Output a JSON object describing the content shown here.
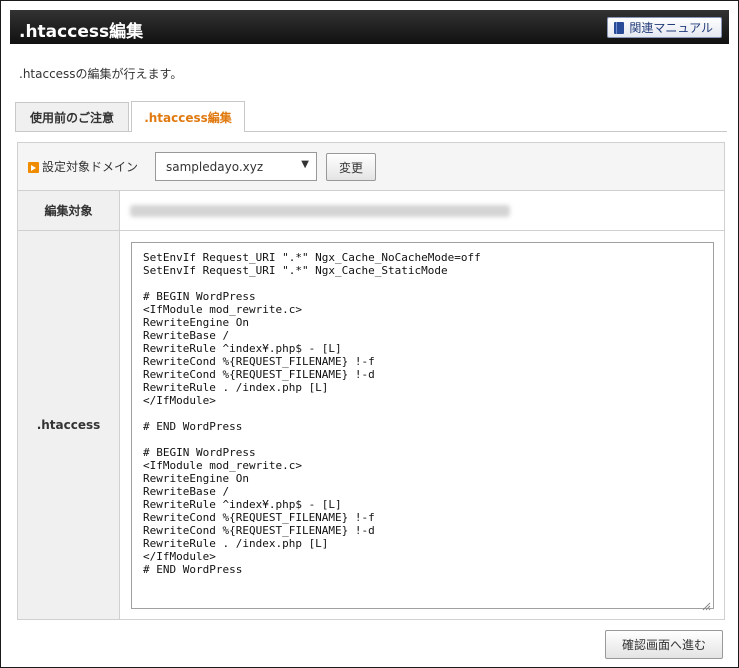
{
  "header": {
    "title": ".htaccess編集",
    "manual_label": "関連マニュアル"
  },
  "intro_text": ".htaccessの編集が行えます。",
  "tabs": [
    {
      "label": "使用前のご注意",
      "active": false
    },
    {
      "label": ".htaccess編集",
      "active": true
    }
  ],
  "domain": {
    "label": "設定対象ドメイン",
    "selected": "sampledayo.xyz",
    "change_label": "変更"
  },
  "edit_target": {
    "label": "編集対象"
  },
  "htaccess": {
    "label": ".htaccess",
    "content": "SetEnvIf Request_URI \".*\" Ngx_Cache_NoCacheMode=off\nSetEnvIf Request_URI \".*\" Ngx_Cache_StaticMode\n\n# BEGIN WordPress\n<IfModule mod_rewrite.c>\nRewriteEngine On\nRewriteBase /\nRewriteRule ^index¥.php$ - [L]\nRewriteCond %{REQUEST_FILENAME} !-f\nRewriteCond %{REQUEST_FILENAME} !-d\nRewriteRule . /index.php [L]\n</IfModule>\n\n# END WordPress\n\n# BEGIN WordPress\n<IfModule mod_rewrite.c>\nRewriteEngine On\nRewriteBase /\nRewriteRule ^index¥.php$ - [L]\nRewriteCond %{REQUEST_FILENAME} !-f\nRewriteCond %{REQUEST_FILENAME} !-d\nRewriteRule . /index.php [L]\n</IfModule>\n# END WordPress"
  },
  "confirm_label": "確認画面へ進む",
  "colors": {
    "active_tab": "#e07a10",
    "titlebar": "#1a1a1a",
    "manual_text": "#223c7a"
  }
}
